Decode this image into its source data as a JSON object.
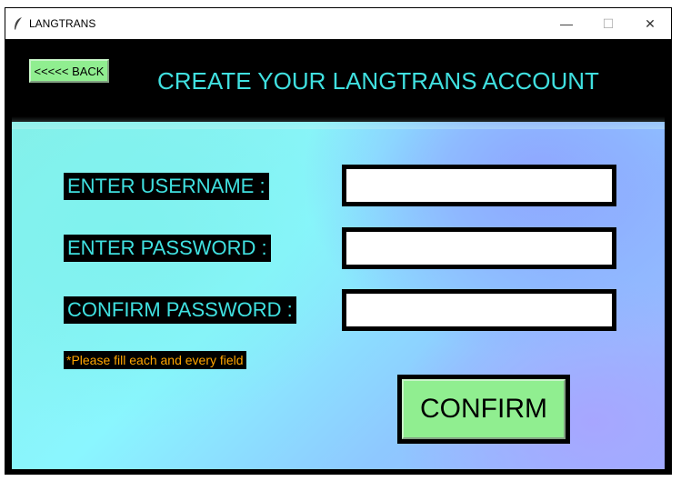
{
  "window": {
    "title": "LANGTRANS",
    "icon": "feather-icon",
    "controls": {
      "minimize": "—",
      "maximize": "☐",
      "close": "✕"
    }
  },
  "header": {
    "back_label": "<<<<< BACK",
    "title": "CREATE YOUR LANGTRANS ACCOUNT"
  },
  "form": {
    "username_label": "ENTER USERNAME :",
    "username_value": "",
    "password_label": "ENTER PASSWORD :",
    "password_value": "",
    "confirm_label": "CONFIRM PASSWORD :",
    "confirm_value": "",
    "hint": "*Please fill each and every field",
    "confirm_button": "CONFIRM"
  },
  "colors": {
    "accent_text": "#40e0e0",
    "button_bg": "#90ee90",
    "hint_text": "#ffa500"
  }
}
